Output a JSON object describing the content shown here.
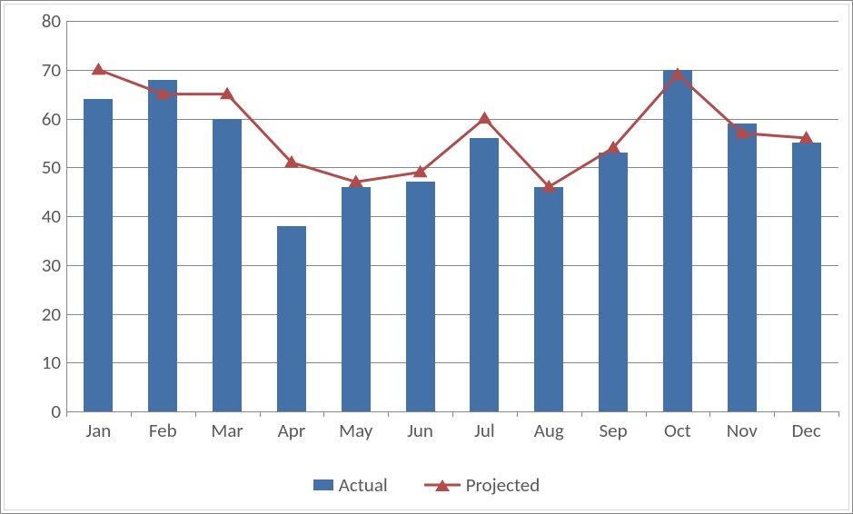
{
  "chart_data": {
    "type": "bar+line",
    "categories": [
      "Jan",
      "Feb",
      "Mar",
      "Apr",
      "May",
      "Jun",
      "Jul",
      "Aug",
      "Sep",
      "Oct",
      "Nov",
      "Dec"
    ],
    "series": [
      {
        "name": "Actual",
        "kind": "bar",
        "color": "#4472a8",
        "values": [
          64,
          68,
          60,
          38,
          46,
          47,
          56,
          46,
          53,
          70,
          59,
          55
        ]
      },
      {
        "name": "Projected",
        "kind": "line",
        "color": "#b24b49",
        "values": [
          70,
          65,
          65,
          51,
          47,
          49,
          60,
          46,
          54,
          69,
          57,
          56
        ]
      }
    ],
    "y_ticks": [
      0,
      10,
      20,
      30,
      40,
      50,
      60,
      70,
      80
    ],
    "ylim": [
      0,
      80
    ],
    "xlabel": "",
    "ylabel": "",
    "title": "",
    "legend_position": "bottom"
  },
  "legend": {
    "actual": "Actual",
    "projected": "Projected"
  },
  "y_labels": {
    "t0": "0",
    "t10": "10",
    "t20": "20",
    "t30": "30",
    "t40": "40",
    "t50": "50",
    "t60": "60",
    "t70": "70",
    "t80": "80"
  },
  "x_labels": {
    "m0": "Jan",
    "m1": "Feb",
    "m2": "Mar",
    "m3": "Apr",
    "m4": "May",
    "m5": "Jun",
    "m6": "Jul",
    "m7": "Aug",
    "m8": "Sep",
    "m9": "Oct",
    "m10": "Nov",
    "m11": "Dec"
  }
}
